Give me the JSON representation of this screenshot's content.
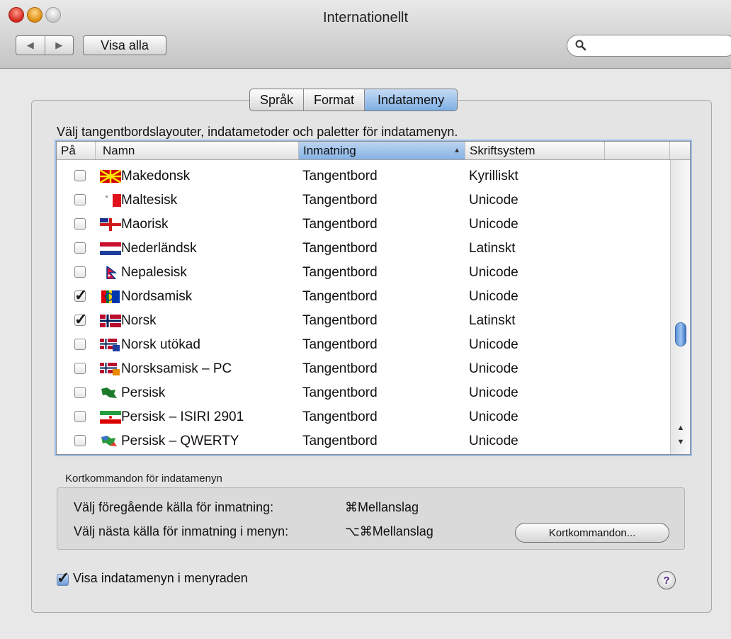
{
  "window": {
    "title": "Internationellt"
  },
  "toolbar": {
    "back_icon": "◀",
    "forward_icon": "▶",
    "show_all_label": "Visa alla",
    "search_placeholder": ""
  },
  "tabs": [
    {
      "label": "Språk",
      "active": false
    },
    {
      "label": "Format",
      "active": false
    },
    {
      "label": "Indatameny",
      "active": true
    }
  ],
  "instructions": "Välj tangentbordslayouter, indatametoder och paletter för indatamenyn.",
  "table": {
    "columns": [
      "På",
      "Namn",
      "Inmatning",
      "Skriftsystem"
    ],
    "sort_arrow": "▲",
    "rows": [
      {
        "on": false,
        "name": "Makedonsk",
        "input": "Tangentbord",
        "script": "Kyrilliskt"
      },
      {
        "on": false,
        "name": "Maltesisk",
        "input": "Tangentbord",
        "script": "Unicode"
      },
      {
        "on": false,
        "name": "Maorisk",
        "input": "Tangentbord",
        "script": "Unicode"
      },
      {
        "on": false,
        "name": "Nederländsk",
        "input": "Tangentbord",
        "script": "Latinskt"
      },
      {
        "on": false,
        "name": "Nepalesisk",
        "input": "Tangentbord",
        "script": "Unicode"
      },
      {
        "on": true,
        "name": "Nordsamisk",
        "input": "Tangentbord",
        "script": "Unicode"
      },
      {
        "on": true,
        "name": "Norsk",
        "input": "Tangentbord",
        "script": "Latinskt"
      },
      {
        "on": false,
        "name": "Norsk utökad",
        "input": "Tangentbord",
        "script": "Unicode"
      },
      {
        "on": false,
        "name": "Norsksamisk – PC",
        "input": "Tangentbord",
        "script": "Unicode"
      },
      {
        "on": false,
        "name": "Persisk",
        "input": "Tangentbord",
        "script": "Unicode"
      },
      {
        "on": false,
        "name": "Persisk – ISIRI 2901",
        "input": "Tangentbord",
        "script": "Unicode"
      },
      {
        "on": false,
        "name": "Persisk – QWERTY",
        "input": "Tangentbord",
        "script": "Unicode"
      }
    ]
  },
  "shortcuts": {
    "group_label": "Kortkommandon för indatamenyn",
    "prev_label": "Välj föregående källa för inmatning:",
    "prev_key": "⌘Mellanslag",
    "next_label": "Välj nästa källa för inmatning i menyn:",
    "next_key": "⌥⌘Mellanslag",
    "button_label": "Kortkommandon..."
  },
  "footer": {
    "show_menu_label": "Visa indatamenyn i menyraden",
    "show_menu_checked": true,
    "help_label": "?"
  },
  "check_glyph": "✓",
  "scroll": {
    "up_icon": "▲",
    "down_icon": "▼"
  }
}
